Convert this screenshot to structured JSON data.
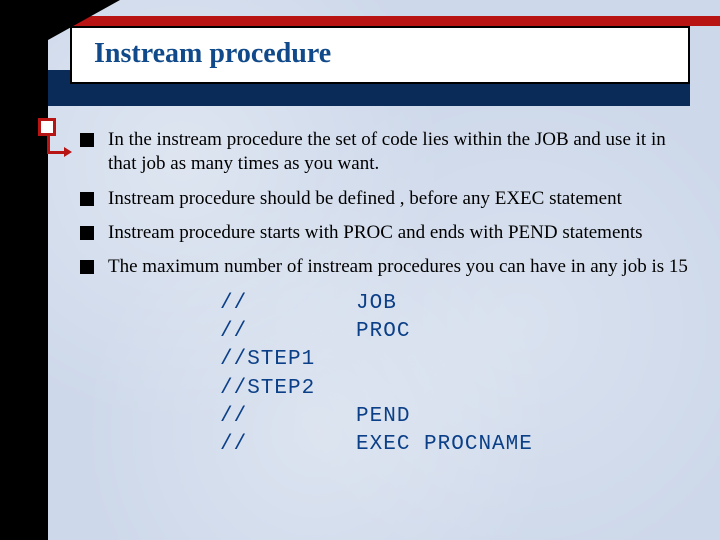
{
  "title": "Instream procedure",
  "bullets": [
    "In the instream procedure the set of code lies within the JOB and use it in that job as many times as you want.",
    "Instream procedure should be defined , before any EXEC statement",
    "Instream procedure starts with PROC and ends with PEND statements",
    "The maximum number of instream procedures you can have in any job is 15"
  ],
  "code": "//        JOB\n//        PROC\n//STEP1\n//STEP2\n//        PEND\n//        EXEC PROCNAME"
}
